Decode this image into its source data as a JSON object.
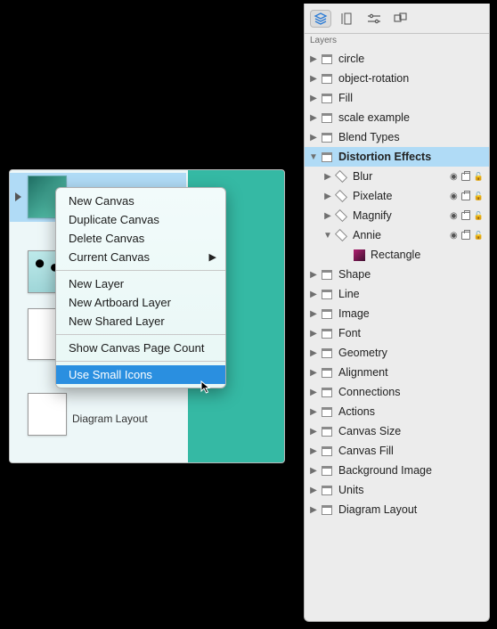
{
  "left": {
    "thumb_caption": "Diagram Layout"
  },
  "context_menu": {
    "items_a": [
      "New Canvas",
      "Duplicate Canvas",
      "Delete Canvas"
    ],
    "current_canvas": "Current Canvas",
    "items_b": [
      "New Layer",
      "New Artboard Layer",
      "New Shared Layer"
    ],
    "show_count": "Show Canvas Page Count",
    "use_small_icons": "Use Small Icons"
  },
  "inspector": {
    "title": "Layers",
    "canvases": [
      "circle",
      "object-rotation",
      "Fill",
      "scale example",
      "Blend Types"
    ],
    "selected_canvas": "Distortion Effects",
    "layers": [
      "Blur",
      "Pixelate",
      "Magnify",
      "Annie"
    ],
    "rect_label": "Rectangle",
    "canvases_after": [
      "Shape",
      "Line",
      "Image",
      "Font",
      "Geometry",
      "Alignment",
      "Connections",
      "Actions",
      "Canvas Size",
      "Canvas Fill",
      "Background Image",
      "Units",
      "Diagram Layout"
    ]
  }
}
